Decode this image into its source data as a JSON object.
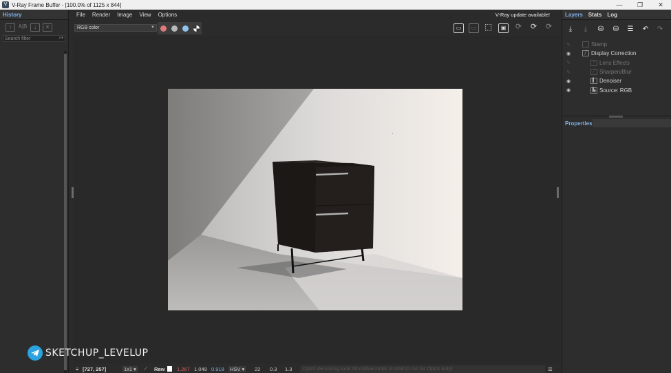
{
  "window": {
    "title": "V-Ray Frame Buffer - [100.0% of 1125 x 844]",
    "controls": [
      "—",
      "❐",
      "✕"
    ]
  },
  "left_panel": {
    "tab": "History",
    "search_placeholder": "Search filter"
  },
  "menu": {
    "items": [
      "File",
      "Render",
      "Image",
      "View",
      "Options"
    ],
    "notice": "V-Ray update available!"
  },
  "toolbar": {
    "channel": "RGB color",
    "dots": [
      "#e07a7a",
      "#b8b8b8",
      "#8ec4f0"
    ]
  },
  "right_panel": {
    "tabs": [
      "Layers",
      "Stats",
      "Log"
    ],
    "layers": [
      {
        "label": "Stamp",
        "enabled": false
      },
      {
        "label": "Display Correction",
        "enabled": true
      },
      {
        "label": "Lens Effects",
        "enabled": false
      },
      {
        "label": "Sharpen/Blur",
        "enabled": false
      },
      {
        "label": "Denoiser",
        "enabled": true
      },
      {
        "label": "Source: RGB",
        "enabled": true
      }
    ],
    "properties_label": "Properties"
  },
  "status": {
    "coords": "[727, 257]",
    "sampling": "1x1",
    "mode": "Raw",
    "r": "1.267",
    "g": "1.049",
    "b": "0.918",
    "colorspace": "HSV",
    "h": "22",
    "s": "0.3",
    "v": "1.3",
    "message": "OptiX denoising took 30 milliseconds in total (0 ms for OptiX only)"
  },
  "watermark": {
    "text": "SKETCHUP_LEVELUP"
  },
  "colors": {
    "accent": "#7fb0e6",
    "background": "#2b2b2b",
    "status_red": "#e06060",
    "status_blue": "#7fb0e6"
  }
}
